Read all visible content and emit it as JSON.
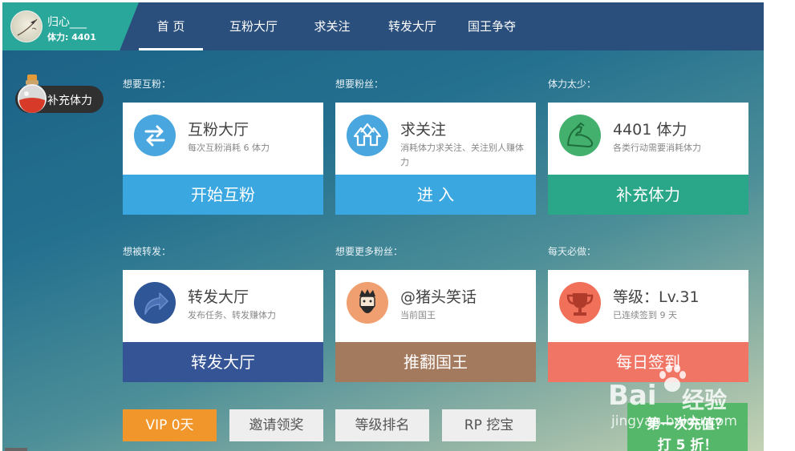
{
  "user": {
    "name": "归心___",
    "energy_label": "体力: 4401"
  },
  "nav": {
    "items": [
      {
        "label": "首 页",
        "active": true
      },
      {
        "label": "互粉大厅",
        "active": false
      },
      {
        "label": "求关注",
        "active": false
      },
      {
        "label": "转发大厅",
        "active": false
      },
      {
        "label": "国王争夺",
        "active": false
      }
    ]
  },
  "side_pill": {
    "label": "补充体力",
    "icon": "potion-icon"
  },
  "sections": [
    {
      "title": "想要互粉："
    },
    {
      "title": "想要粉丝："
    },
    {
      "title": "体力太少："
    },
    {
      "title": "想被转发："
    },
    {
      "title": "想要更多粉丝："
    },
    {
      "title": "每天必做："
    }
  ],
  "cards": [
    {
      "title": "互粉大厅",
      "desc": "每次互粉消耗 6 体力",
      "button": "开始互粉",
      "icon": "exchange-arrows-icon",
      "icon_color": "#4aa6de",
      "button_color": "#3ba7e0"
    },
    {
      "title": "求关注",
      "desc": "消耗体力求关注、关注别人赚体力",
      "button": "进  入",
      "icon": "up-arrows-icon",
      "icon_color": "#4aa6de",
      "button_color": "#3ba7e0"
    },
    {
      "title": "4401 体力",
      "desc": "各类行动需要消耗体力",
      "button": "补充体力",
      "icon": "muscle-arm-icon",
      "icon_color": "#43b06e",
      "button_color": "#2aa688"
    },
    {
      "title": "转发大厅",
      "desc": "发布任务、转发赚体力",
      "button": "转发大厅",
      "icon": "forward-arrow-icon",
      "icon_color": "#2f5696",
      "button_color": "#345495"
    },
    {
      "title": "@猪头笑话",
      "desc": "当前国王",
      "button": "推翻国王",
      "icon": "king-avatar-icon",
      "icon_color": "#f0a070",
      "button_color": "#a47a5e"
    },
    {
      "title": "等级：Lv.31",
      "desc": "已连续签到 9 天",
      "button": "每日签到",
      "icon": "trophy-icon",
      "icon_color": "#f0705a",
      "button_color": "#f07565"
    }
  ],
  "bottom": {
    "vip": "VIP 0天",
    "invite": "邀请领奖",
    "ranking": "等级排名",
    "rp": "RP 挖宝"
  },
  "recharge": {
    "line1": "第一次充值？",
    "line2": "打 5 折！"
  },
  "watermark": {
    "logo": "Bai",
    "text": "经验",
    "sub": "jingyan.baidu.com"
  }
}
